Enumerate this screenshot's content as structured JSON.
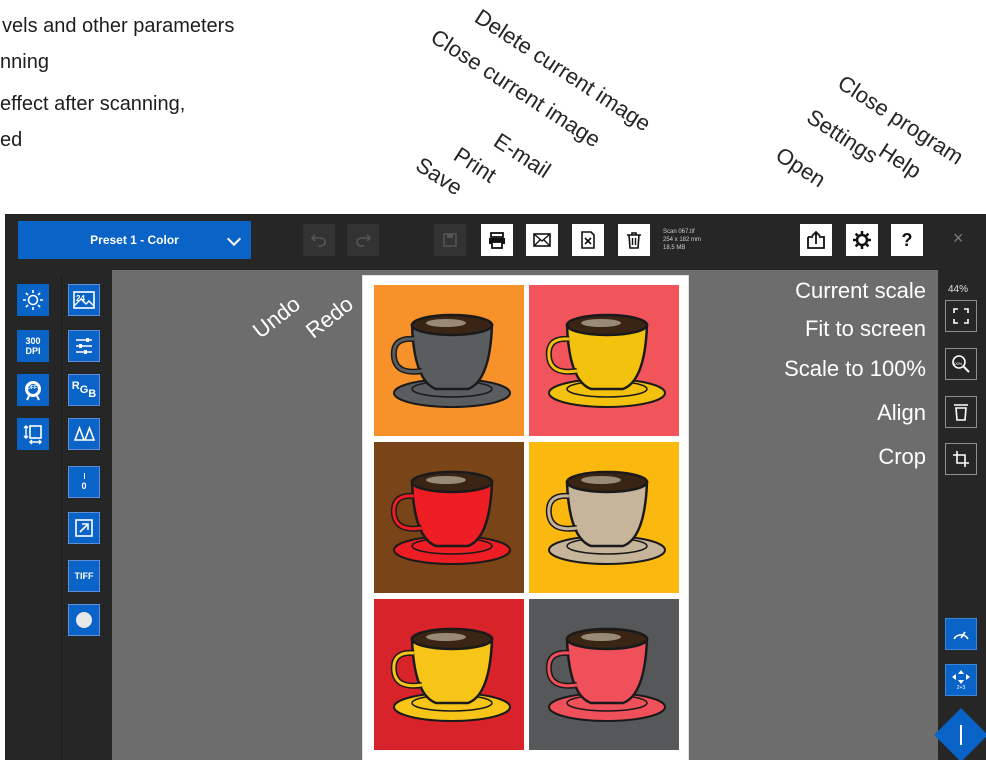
{
  "annotations": {
    "notes": [
      "vels and other parameters",
      "nning",
      "effect after scanning,",
      "ed"
    ],
    "top_labels": {
      "save": "Save",
      "print": "Print",
      "email": "E-mail",
      "close_current_image": "Close current image",
      "delete_current_image": "Delete current image",
      "open": "Open",
      "settings": "Settings",
      "help": "Help",
      "close_program": "Close program"
    },
    "work_labels": {
      "undo": "Undo",
      "redo": "Redo",
      "current_scale": "Current scale",
      "fit_to_screen": "Fit to screen",
      "scale_to_100": "Scale to 100%",
      "align": "Align",
      "crop": "Crop"
    }
  },
  "toolbar": {
    "preset_label": "Preset 1 - Color",
    "file": {
      "name": "Scan 067.tif",
      "dimensions": "254 x 182 mm",
      "size": "18,5 MB"
    },
    "close_glyph": "×",
    "help_glyph": "?"
  },
  "left_tools": {
    "dpi_line1": "300",
    "dpi_line2": "DPI",
    "off_badge": "OFF",
    "count_badge": "24",
    "rgb_r": "R",
    "rgb_g": "G",
    "rgb_b": "B",
    "counter_value": "0",
    "tiff_label": "TIFF"
  },
  "right_tools": {
    "current_scale_value": "44%",
    "scale_100_badge": "100%",
    "duplex_badge": "2+3"
  },
  "colors": {
    "accent": "#0a63c6",
    "chrome": "#262626",
    "workspace": "#6d6d6d",
    "tiles": [
      {
        "bg": "#f7922a",
        "cup": "#5a5d60"
      },
      {
        "bg": "#f2545c",
        "cup": "#f2c20f"
      },
      {
        "bg": "#7a4419",
        "cup": "#ee1d23"
      },
      {
        "bg": "#fbb80f",
        "cup": "#c6b49b"
      },
      {
        "bg": "#d8232a",
        "cup": "#f6c518"
      },
      {
        "bg": "#555759",
        "cup": "#f0505a"
      }
    ]
  },
  "icons": [
    "brightness-icon",
    "auto-color-icon",
    "settings-toggle-icon",
    "levels-icon",
    "rotate-icon",
    "contrast-icon",
    "resize-icon",
    "circle-icon"
  ]
}
